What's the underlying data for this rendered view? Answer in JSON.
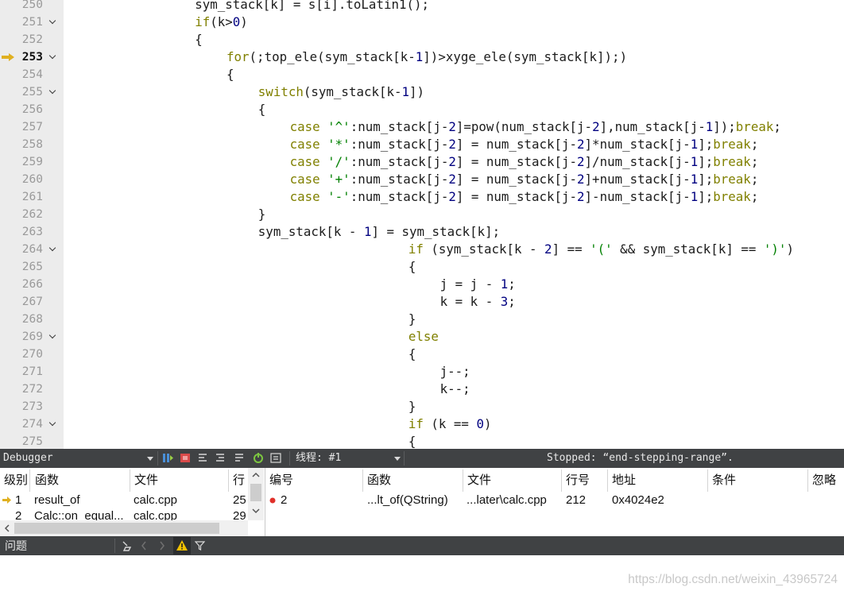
{
  "editor": {
    "current_line": 253,
    "lines": [
      {
        "n": "250",
        "fold": false,
        "indent": 16,
        "tokens": [
          [
            "t",
            "sym_stack[k] = s[i].toLatin1();"
          ]
        ]
      },
      {
        "n": "251",
        "fold": true,
        "indent": 16,
        "tokens": [
          [
            "kw",
            "if"
          ],
          [
            "t",
            "(k>"
          ],
          [
            "num",
            "0"
          ],
          [
            "t",
            ")"
          ]
        ]
      },
      {
        "n": "252",
        "fold": false,
        "indent": 16,
        "tokens": [
          [
            "t",
            "{"
          ]
        ]
      },
      {
        "n": "253",
        "fold": true,
        "indent": 20,
        "tokens": [
          [
            "kw",
            "for"
          ],
          [
            "t",
            "(;top_ele(sym_stack[k-"
          ],
          [
            "num",
            "1"
          ],
          [
            "t",
            "])>xyge_ele(sym_stack[k]);)"
          ]
        ]
      },
      {
        "n": "254",
        "fold": false,
        "indent": 20,
        "tokens": [
          [
            "t",
            "{"
          ]
        ]
      },
      {
        "n": "255",
        "fold": true,
        "indent": 24,
        "tokens": [
          [
            "kw",
            "switch"
          ],
          [
            "t",
            "(sym_stack[k-"
          ],
          [
            "num",
            "1"
          ],
          [
            "t",
            "])"
          ]
        ]
      },
      {
        "n": "256",
        "fold": false,
        "indent": 24,
        "tokens": [
          [
            "t",
            "{"
          ]
        ]
      },
      {
        "n": "257",
        "fold": false,
        "indent": 28,
        "tokens": [
          [
            "kw",
            "case"
          ],
          [
            "t",
            " "
          ],
          [
            "str",
            "'^'"
          ],
          [
            "t",
            ":num_stack[j-"
          ],
          [
            "num",
            "2"
          ],
          [
            "t",
            "]=pow(num_stack[j-"
          ],
          [
            "num",
            "2"
          ],
          [
            "t",
            "],num_stack[j-"
          ],
          [
            "num",
            "1"
          ],
          [
            "t",
            "]);"
          ],
          [
            "kw",
            "break"
          ],
          [
            "t",
            ";"
          ]
        ]
      },
      {
        "n": "258",
        "fold": false,
        "indent": 28,
        "tokens": [
          [
            "kw",
            "case"
          ],
          [
            "t",
            " "
          ],
          [
            "str",
            "'*'"
          ],
          [
            "t",
            ":num_stack[j-"
          ],
          [
            "num",
            "2"
          ],
          [
            "t",
            "] = num_stack[j-"
          ],
          [
            "num",
            "2"
          ],
          [
            "t",
            "]*num_stack[j-"
          ],
          [
            "num",
            "1"
          ],
          [
            "t",
            "];"
          ],
          [
            "kw",
            "break"
          ],
          [
            "t",
            ";"
          ]
        ]
      },
      {
        "n": "259",
        "fold": false,
        "indent": 28,
        "tokens": [
          [
            "kw",
            "case"
          ],
          [
            "t",
            " "
          ],
          [
            "str",
            "'/'"
          ],
          [
            "t",
            ":num_stack[j-"
          ],
          [
            "num",
            "2"
          ],
          [
            "t",
            "] = num_stack[j-"
          ],
          [
            "num",
            "2"
          ],
          [
            "t",
            "]/num_stack[j-"
          ],
          [
            "num",
            "1"
          ],
          [
            "t",
            "];"
          ],
          [
            "kw",
            "break"
          ],
          [
            "t",
            ";"
          ]
        ]
      },
      {
        "n": "260",
        "fold": false,
        "indent": 28,
        "tokens": [
          [
            "kw",
            "case"
          ],
          [
            "t",
            " "
          ],
          [
            "str",
            "'+'"
          ],
          [
            "t",
            ":num_stack[j-"
          ],
          [
            "num",
            "2"
          ],
          [
            "t",
            "] = num_stack[j-"
          ],
          [
            "num",
            "2"
          ],
          [
            "t",
            "]+num_stack[j-"
          ],
          [
            "num",
            "1"
          ],
          [
            "t",
            "];"
          ],
          [
            "kw",
            "break"
          ],
          [
            "t",
            ";"
          ]
        ]
      },
      {
        "n": "261",
        "fold": false,
        "indent": 28,
        "tokens": [
          [
            "kw",
            "case"
          ],
          [
            "t",
            " "
          ],
          [
            "str",
            "'-'"
          ],
          [
            "t",
            ":num_stack[j-"
          ],
          [
            "num",
            "2"
          ],
          [
            "t",
            "] = num_stack[j-"
          ],
          [
            "num",
            "2"
          ],
          [
            "t",
            "]-num_stack[j-"
          ],
          [
            "num",
            "1"
          ],
          [
            "t",
            "];"
          ],
          [
            "kw",
            "break"
          ],
          [
            "t",
            ";"
          ]
        ]
      },
      {
        "n": "262",
        "fold": false,
        "indent": 24,
        "tokens": [
          [
            "t",
            "}"
          ]
        ]
      },
      {
        "n": "263",
        "fold": false,
        "indent": 24,
        "tokens": [
          [
            "t",
            "sym_stack[k - "
          ],
          [
            "num",
            "1"
          ],
          [
            "t",
            "] = sym_stack[k];"
          ]
        ]
      },
      {
        "n": "264",
        "fold": true,
        "indent": 43,
        "tokens": [
          [
            "kw",
            "if"
          ],
          [
            "t",
            " (sym_stack[k - "
          ],
          [
            "num",
            "2"
          ],
          [
            "t",
            "] == "
          ],
          [
            "str",
            "'('"
          ],
          [
            "t",
            " && sym_stack[k] == "
          ],
          [
            "str",
            "')'"
          ],
          [
            "t",
            ")"
          ]
        ]
      },
      {
        "n": "265",
        "fold": false,
        "indent": 43,
        "tokens": [
          [
            "t",
            "{"
          ]
        ]
      },
      {
        "n": "266",
        "fold": false,
        "indent": 47,
        "tokens": [
          [
            "t",
            "j = j - "
          ],
          [
            "num",
            "1"
          ],
          [
            "t",
            ";"
          ]
        ]
      },
      {
        "n": "267",
        "fold": false,
        "indent": 47,
        "tokens": [
          [
            "t",
            "k = k - "
          ],
          [
            "num",
            "3"
          ],
          [
            "t",
            ";"
          ]
        ]
      },
      {
        "n": "268",
        "fold": false,
        "indent": 43,
        "tokens": [
          [
            "t",
            "}"
          ]
        ]
      },
      {
        "n": "269",
        "fold": true,
        "indent": 43,
        "tokens": [
          [
            "kw",
            "else"
          ]
        ]
      },
      {
        "n": "270",
        "fold": false,
        "indent": 43,
        "tokens": [
          [
            "t",
            "{"
          ]
        ]
      },
      {
        "n": "271",
        "fold": false,
        "indent": 47,
        "tokens": [
          [
            "t",
            "j--;"
          ]
        ]
      },
      {
        "n": "272",
        "fold": false,
        "indent": 47,
        "tokens": [
          [
            "t",
            "k--;"
          ]
        ]
      },
      {
        "n": "273",
        "fold": false,
        "indent": 43,
        "tokens": [
          [
            "t",
            "}"
          ]
        ]
      },
      {
        "n": "274",
        "fold": true,
        "indent": 43,
        "tokens": [
          [
            "kw",
            "if"
          ],
          [
            "t",
            " (k == "
          ],
          [
            "num",
            "0"
          ],
          [
            "t",
            ")"
          ]
        ]
      },
      {
        "n": "275",
        "fold": false,
        "indent": 43,
        "tokens": [
          [
            "t",
            "{"
          ]
        ]
      }
    ]
  },
  "debugger_bar": {
    "selector": "Debugger",
    "thread_label": "线程: #1",
    "status": "Stopped: “end-stepping-range”."
  },
  "stack": {
    "headers": [
      "级别",
      "函数",
      "文件",
      "行"
    ],
    "rows": [
      {
        "level": "1",
        "function": "result_of",
        "file": "calc.cpp",
        "line": "25"
      },
      {
        "level": "2",
        "function": "Calc::on_equal...",
        "file": "calc.cpp",
        "line": "29"
      }
    ]
  },
  "breakpoints": {
    "headers": [
      "编号",
      "函数",
      "文件",
      "行号",
      "地址",
      "条件",
      "忽略"
    ],
    "rows": [
      {
        "id": "2",
        "function": "...lt_of(QString)",
        "file": "...later\\calc.cpp",
        "line": "212",
        "address": "0x4024e2"
      }
    ]
  },
  "issues_bar": {
    "title": "问题"
  },
  "watermark": "https://blog.csdn.net/weixin_43965724",
  "colors": {
    "keyword": "#808000",
    "number": "#000080",
    "string": "#008000",
    "toolbar_bg": "#404244",
    "breakpoint": "#e0302a",
    "current_arrow": "#e0b020"
  }
}
